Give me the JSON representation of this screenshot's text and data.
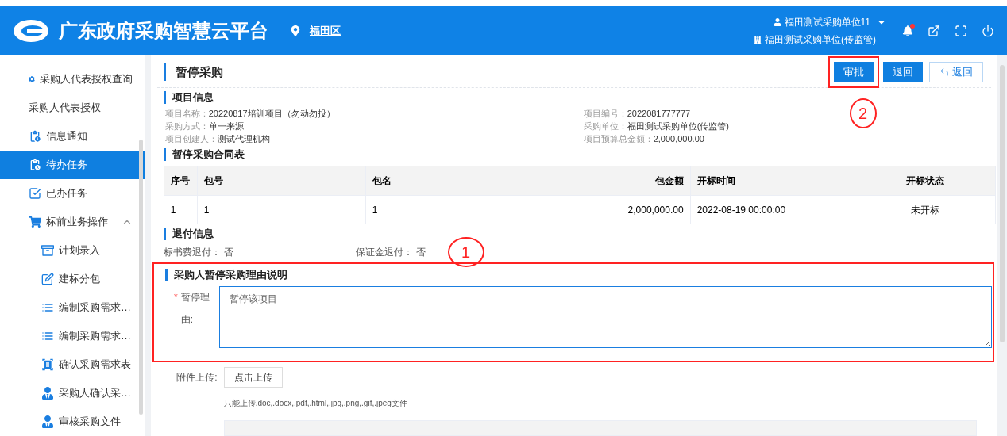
{
  "header": {
    "title": "广东政府采购智慧云平台",
    "region": "福田区",
    "user": "福田测试采购单位11",
    "org": "福田测试采购单位(传监管)",
    "has_notification": true
  },
  "sidebar": {
    "items": [
      {
        "label": "采购人代表授权查询",
        "selected": false
      },
      {
        "label": "采购人代表授权",
        "selected": false
      },
      {
        "label": "信息通知",
        "selected": false
      },
      {
        "label": "待办任务",
        "selected": true
      },
      {
        "label": "已办任务",
        "selected": false
      },
      {
        "label": "标前业务操作",
        "selected": false,
        "expanded": true,
        "children": [
          {
            "label": "计划录入",
            "selected": false
          },
          {
            "label": "建标分包",
            "selected": false
          },
          {
            "label": "编制采购需求…",
            "selected": false
          },
          {
            "label": "编制采购需求…",
            "selected": false
          },
          {
            "label": "确认采购需求表",
            "selected": false
          },
          {
            "label": "采购人确认采…",
            "selected": false
          },
          {
            "label": "审核采购文件",
            "selected": false
          }
        ]
      }
    ]
  },
  "page": {
    "title": "暂停采购",
    "buttons": [
      {
        "label": "审批",
        "kind": "primary"
      },
      {
        "label": "退回",
        "kind": "primary"
      },
      {
        "label": "返回",
        "kind": "back"
      }
    ],
    "project_info": {
      "title": "项目信息",
      "fields": [
        {
          "label": "项目名称：",
          "value": "20220817培训项目（勿动勿投）"
        },
        {
          "label": "项目编号：",
          "value": "2022081777777"
        },
        {
          "label": "采购方式：",
          "value": "单一来源"
        },
        {
          "label": "采购单位：",
          "value": "福田测试采购单位(传监管)"
        },
        {
          "label": "项目创建人：",
          "value": "测试代理机构"
        },
        {
          "label": "项目预算总金额：",
          "value": "2,000,000.00"
        }
      ]
    },
    "contract_table": {
      "title": "暂停采购合同表",
      "columns": [
        "序号",
        "包号",
        "包名",
        "包金额",
        "开标时间",
        "开标状态"
      ],
      "rows": [
        [
          "1",
          "1",
          "1",
          "2,000,000.00",
          "2022-08-19 00:00:00",
          "未开标"
        ]
      ]
    },
    "refund": {
      "title": "退付信息",
      "fields": [
        {
          "label": "标书费退付：",
          "value": "否"
        },
        {
          "label": "保证金退付：",
          "value": "否"
        }
      ]
    },
    "reason": {
      "title": "采购人暂停采购理由说明",
      "required_mark": "*",
      "label": "暂停理由:",
      "value": "暂停该项目"
    },
    "upload": {
      "label": "附件上传:",
      "button": "点击上传",
      "hint": "只能上传.doc,.docx,.pdf,.html,.jpg,.png,.gif,.jpeg文件"
    }
  },
  "annotations": [
    "1",
    "2"
  ]
}
